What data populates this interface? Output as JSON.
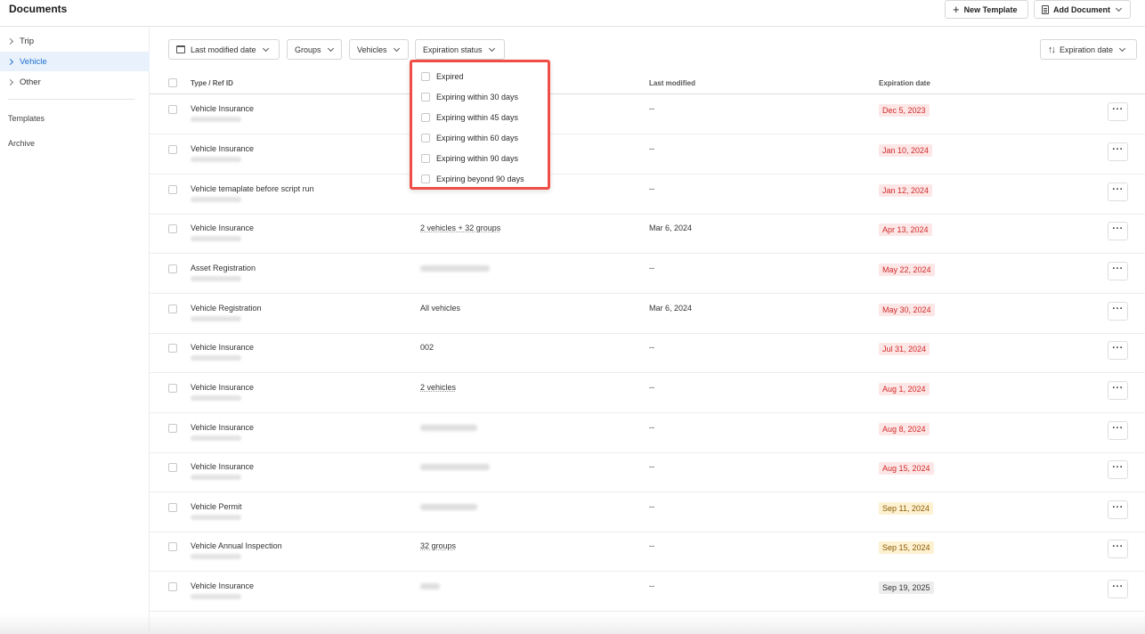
{
  "header": {
    "title": "Documents",
    "new_template_label": "New Template",
    "add_document_label": "Add Document"
  },
  "sidebar": {
    "categories": [
      {
        "label": "Trip",
        "active": false
      },
      {
        "label": "Vehicle",
        "active": true
      },
      {
        "label": "Other",
        "active": false
      }
    ],
    "links": [
      "Templates",
      "Archive"
    ]
  },
  "filters": {
    "last_modified": "Last modified date",
    "groups": "Groups",
    "vehicles": "Vehicles",
    "expiration_status": "Expiration status",
    "sort": "Expiration date"
  },
  "table": {
    "headers": {
      "type": "Type / Ref ID",
      "modified": "Last modified",
      "expiration": "Expiration date"
    },
    "rows": [
      {
        "type": "Vehicle Insurance",
        "assoc": "",
        "modified": "--",
        "expiration": "Dec 5, 2023",
        "status": "red"
      },
      {
        "type": "Vehicle Insurance",
        "assoc": "",
        "modified": "--",
        "expiration": "Jan 10, 2024",
        "status": "red"
      },
      {
        "type": "Vehicle temaplate before script run",
        "assoc": "",
        "modified": "--",
        "expiration": "Jan 12, 2024",
        "status": "red"
      },
      {
        "type": "Vehicle Insurance",
        "assoc": "2 vehicles + 32 groups",
        "modified": "Mar 6, 2024",
        "expiration": "Apr 13, 2024",
        "status": "red"
      },
      {
        "type": "Asset Registration",
        "assoc": "",
        "modified": "--",
        "expiration": "May 22, 2024",
        "status": "red"
      },
      {
        "type": "Vehicle Registration",
        "assoc": "All vehicles",
        "modified": "Mar 6, 2024",
        "expiration": "May 30, 2024",
        "status": "red"
      },
      {
        "type": "Vehicle Insurance",
        "assoc": "002",
        "modified": "--",
        "expiration": "Jul 31, 2024",
        "status": "red"
      },
      {
        "type": "Vehicle Insurance",
        "assoc": "2 vehicles",
        "modified": "--",
        "expiration": "Aug 1, 2024",
        "status": "red"
      },
      {
        "type": "Vehicle Insurance",
        "assoc": "",
        "modified": "--",
        "expiration": "Aug 8, 2024",
        "status": "red"
      },
      {
        "type": "Vehicle Insurance",
        "assoc": "",
        "modified": "--",
        "expiration": "Aug 15, 2024",
        "status": "red"
      },
      {
        "type": "Vehicle Permit",
        "assoc": "",
        "modified": "--",
        "expiration": "Sep 11, 2024",
        "status": "amber"
      },
      {
        "type": "Vehicle Annual Inspection",
        "assoc": "32 groups",
        "modified": "--",
        "expiration": "Sep 15, 2024",
        "status": "amber"
      },
      {
        "type": "Vehicle Insurance",
        "assoc": "",
        "modified": "--",
        "expiration": "Sep 19, 2025",
        "status": "gray"
      }
    ],
    "more_label": "···"
  },
  "expiration_dropdown": {
    "options": [
      "Expired",
      "Expiring within 30 days",
      "Expiring within 45 days",
      "Expiring within 60 days",
      "Expiring within 90 days",
      "Expiring beyond 90 days"
    ],
    "highlight_color": "#ef4d45"
  },
  "colors": {
    "accent": "#1f6fd1",
    "overdue_bg": "#fde6e6",
    "overdue_text": "#d12a2a",
    "soon_bg": "#fdf1d2"
  }
}
